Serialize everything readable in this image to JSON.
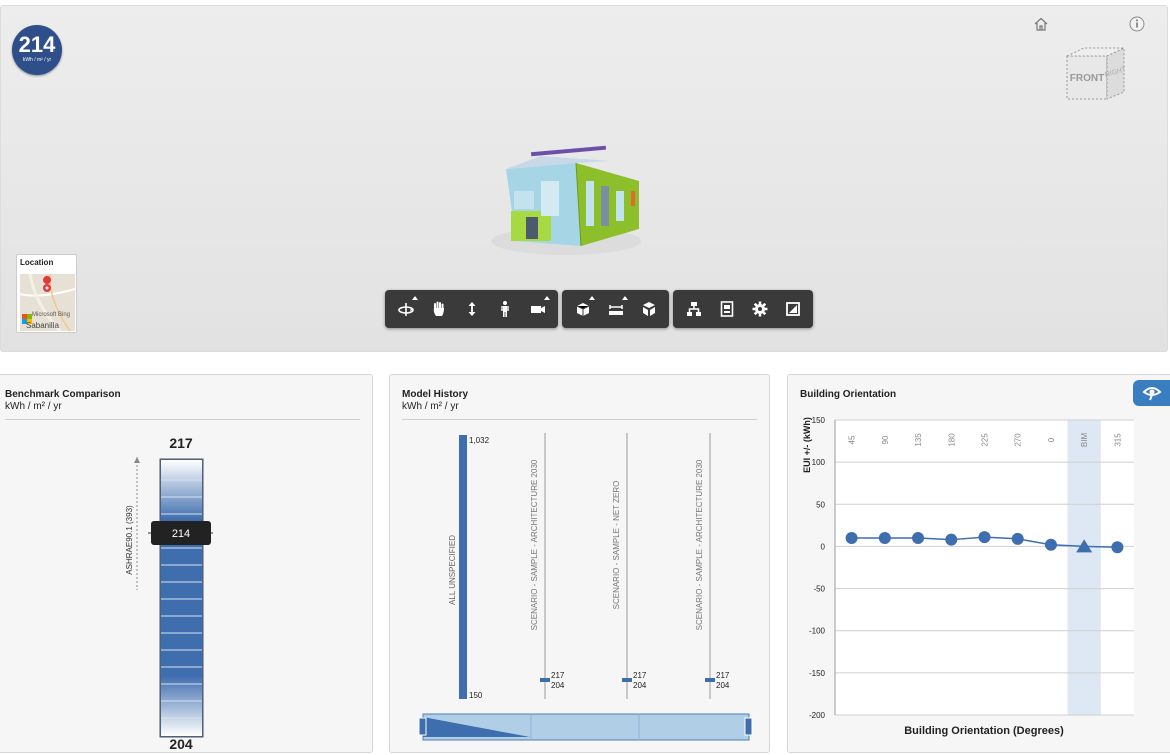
{
  "viewer": {
    "eui_value": "214",
    "eui_unit": "kWh / m² / yr",
    "icons": [
      "home-icon",
      "info-icon"
    ],
    "viewcube_front": "FRONT",
    "viewcube_right": "RIGHT",
    "location_title": "Location",
    "map_brand": "Microsoft Bing",
    "map_place": "Sabanilla",
    "toolbar_groups": [
      [
        "orbit-icon",
        "pan-icon",
        "zoom-icon",
        "walk-icon",
        "camera-icon"
      ],
      [
        "section-icon",
        "measure-icon",
        "explode-icon"
      ],
      [
        "model-browser-icon",
        "properties-icon",
        "settings-icon",
        "fullscreen-icon"
      ]
    ]
  },
  "benchmark": {
    "title": "Benchmark Comparison",
    "unit": "kWh / m² / yr",
    "top_value": "217",
    "bottom_value": "204",
    "current_value": "214",
    "ashrae_label": "ASHRAE90.1 (393)"
  },
  "history": {
    "title": "Model History",
    "unit": "kWh / m² / yr",
    "bars": [
      {
        "label": "ALL UNSPECIFIED",
        "top": "1,032",
        "bottom": "150"
      },
      {
        "label": "SCENARIO - SAMPLE - ARCHITECTURE 2030",
        "top": "217",
        "bottom": "204"
      },
      {
        "label": "SCENARIO - SAMPLE - NET ZERO",
        "top": "217",
        "bottom": "204"
      },
      {
        "label": "SCENARIO - SAMPLE - ARCHITECTURE 2030",
        "top": "217",
        "bottom": "204"
      }
    ]
  },
  "orientation": {
    "title": "Building Orientation",
    "button_icon": "eye-icon"
  },
  "chart_data": {
    "type": "scatter",
    "title": "Building Orientation",
    "xlabel": "Building Orientation (Degrees)",
    "ylabel": "EUI +/- (kWh)",
    "categories": [
      "45",
      "90",
      "135",
      "180",
      "225",
      "270",
      "0",
      "BIM",
      "315"
    ],
    "values": [
      10,
      10,
      10,
      8,
      11,
      9,
      2,
      0,
      -1
    ],
    "highlight": "BIM",
    "ylim": [
      -200,
      150
    ],
    "yticks": [
      150,
      100,
      50,
      0,
      -50,
      -100,
      -150,
      -200
    ],
    "grid": true,
    "colors": {
      "marker": "#3f6eae",
      "highlight_band": "#dde8f4"
    }
  }
}
